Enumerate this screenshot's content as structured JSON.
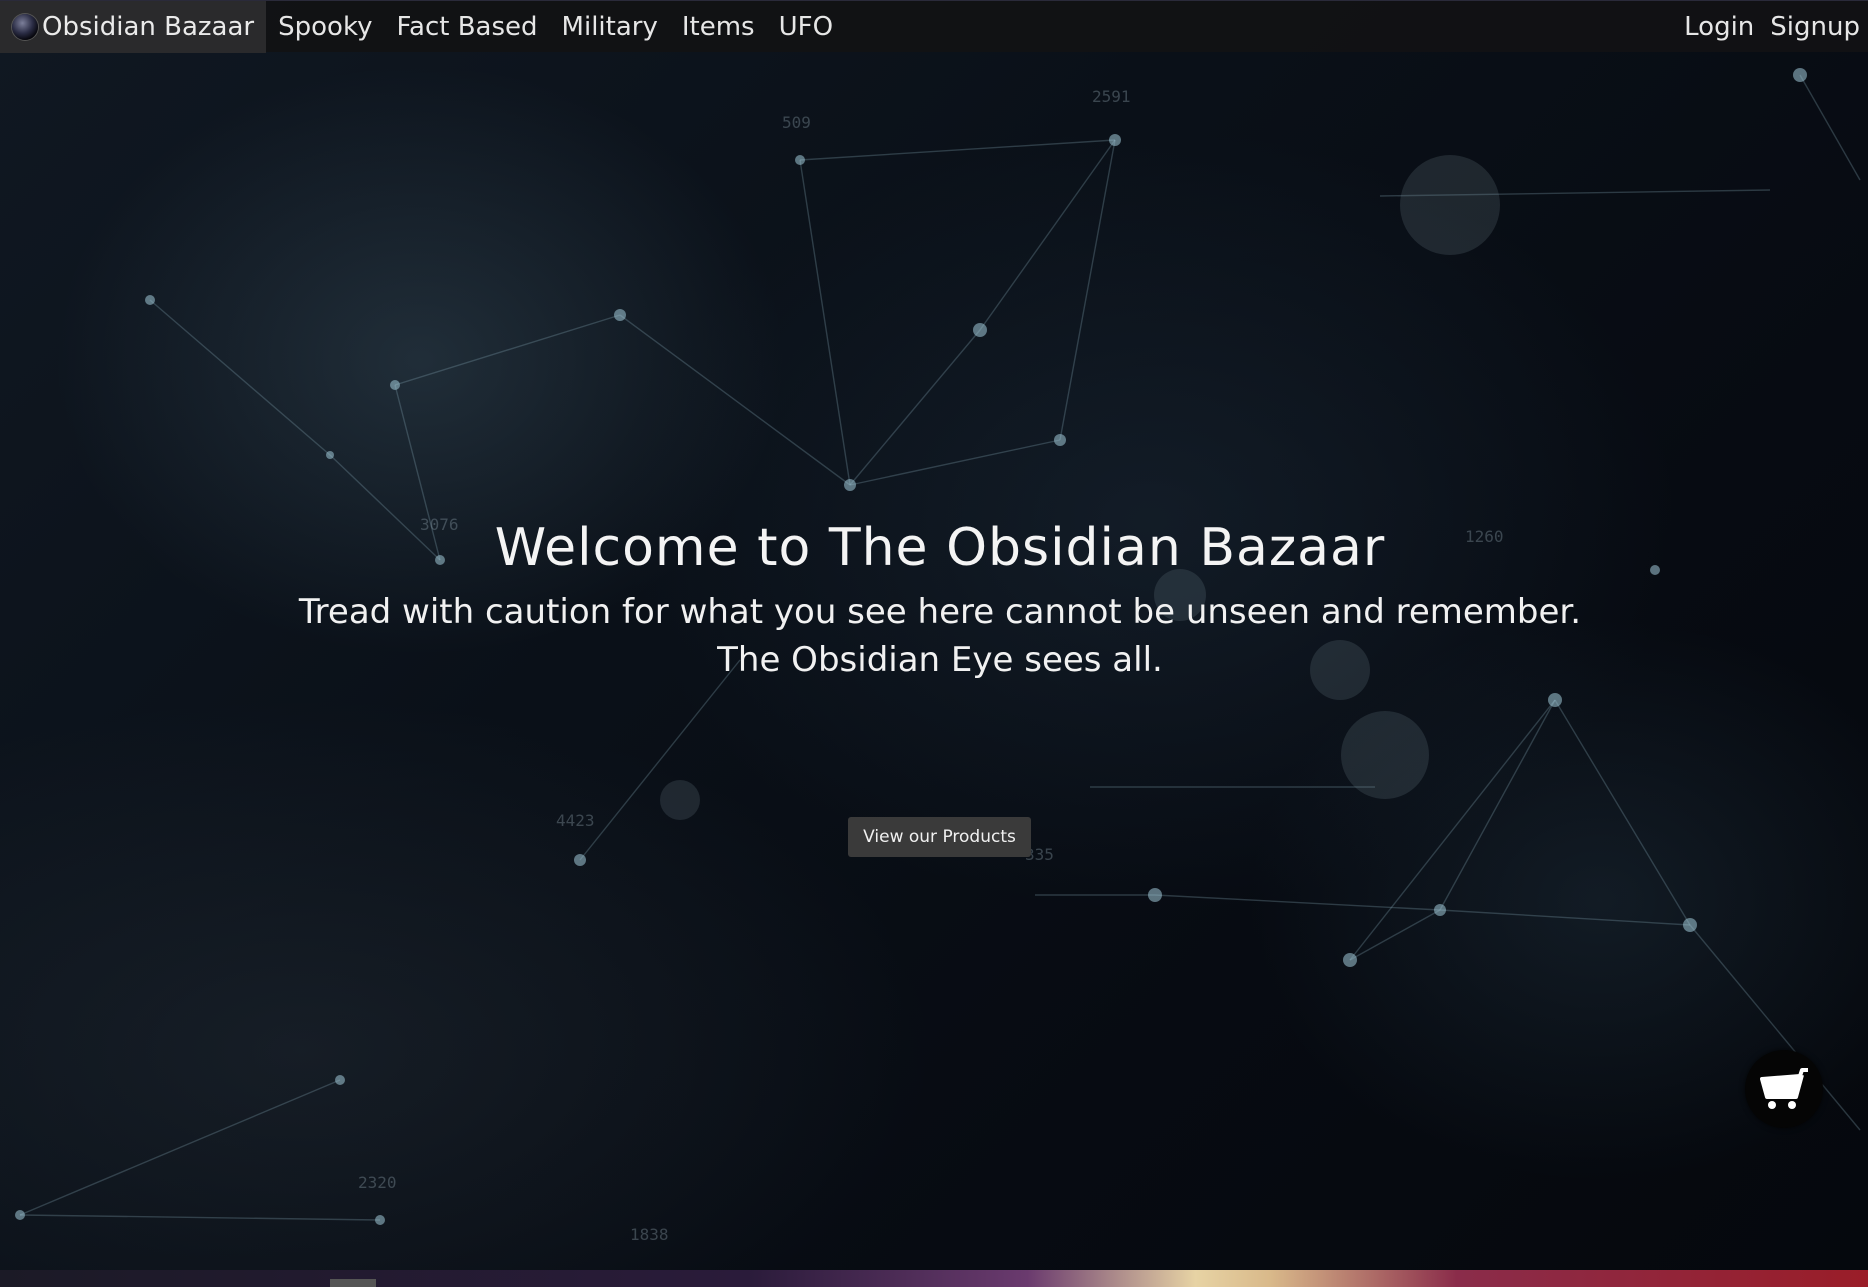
{
  "navbar": {
    "brand_label": "Obsidian Bazaar",
    "links": [
      "Spooky",
      "Fact Based",
      "Military",
      "Items",
      "UFO"
    ],
    "login_label": "Login",
    "signup_label": "Signup"
  },
  "hero": {
    "title": "Welcome to The Obsidian Bazaar",
    "subtitle_line1": "Tread with caution for what you see here cannot be unseen and remember.",
    "subtitle_line2": "The Obsidian Eye sees all.",
    "cta_label": "View our Products"
  },
  "background_numbers": [
    "2591",
    "509",
    "4423",
    "2320",
    "1838",
    "1260",
    "3076",
    "335"
  ],
  "icons": {
    "brand": "obsidian-orb-icon",
    "cart": "shopping-cart-icon"
  },
  "colors": {
    "navbar_bg": "#121214",
    "brand_bg": "#2a2a2c",
    "cta_bg": "#3a3a3a",
    "cart_bg": "#050505"
  }
}
